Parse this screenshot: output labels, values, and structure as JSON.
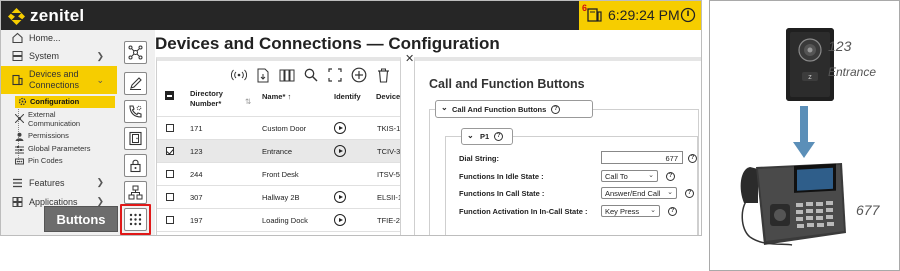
{
  "app": {
    "brand": "zenitel",
    "alert_count": "6",
    "time": "6:29:24 PM"
  },
  "sidebar": {
    "home": "Home...",
    "system": "System",
    "devices": "Devices and Connections",
    "sub_items": {
      "configuration": "Configuration",
      "external": "External Communication",
      "permissions": "Permissions",
      "global": "Global Parameters",
      "pin": "Pin Codes"
    },
    "features": "Features",
    "applications": "Applications"
  },
  "callout": {
    "buttons": "Buttons"
  },
  "page": {
    "title": "Devices and Connections — Configuration"
  },
  "table": {
    "columns": {
      "directory": "Directory Number",
      "name": "Name",
      "identify": "Identify",
      "device": "Device"
    },
    "rows": [
      {
        "dir": "171",
        "name": "Custom Door",
        "device": "TKIS-1,",
        "checked": false
      },
      {
        "dir": "123",
        "name": "Entrance",
        "device": "TCIV-3",
        "checked": true
      },
      {
        "dir": "244",
        "name": "Front Desk",
        "device": "ITSV-5",
        "checked": false
      },
      {
        "dir": "307",
        "name": "Hallway 2B",
        "device": "ELSII-1",
        "checked": false
      },
      {
        "dir": "197",
        "name": "Loading Dock",
        "device": "TFIE-2",
        "checked": false
      }
    ]
  },
  "cfb": {
    "title": "Call and Function Buttons",
    "group_legend": "Call And Function Buttons",
    "button_legend": "P1",
    "dial_label": "Dial String:",
    "dial_value": "677",
    "idle_label": "Functions In Idle State :",
    "idle_value": "Call To",
    "call_label": "Functions In Call State :",
    "call_value": "Answer/End Call",
    "incall_label": "Function Activation In In-Call State :",
    "incall_value": "Key Press"
  },
  "illustration": {
    "intercom_number": "123",
    "intercom_name": "Entrance",
    "phone_number": "677"
  },
  "colors": {
    "accent": "#f6cd00",
    "topbar": "#262626",
    "highlight": "#e01818",
    "arrow": "#5b8fb8"
  }
}
